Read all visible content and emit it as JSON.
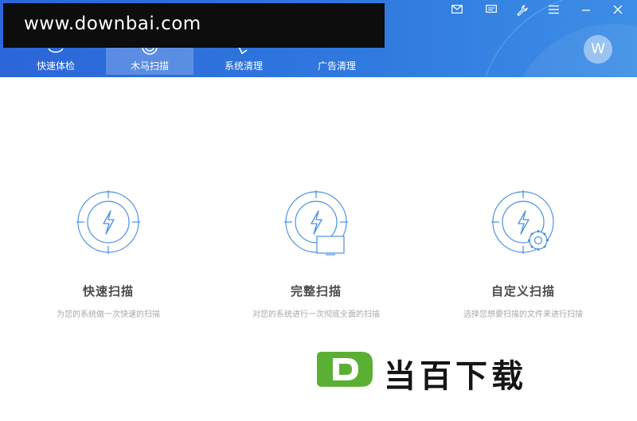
{
  "watermark": {
    "url": "www.downbai.com"
  },
  "nav": {
    "items": [
      {
        "label": "快速体检",
        "active": false
      },
      {
        "label": "木马扫描",
        "active": true
      },
      {
        "label": "系统清理",
        "active": false
      },
      {
        "label": "广告清理",
        "active": false
      }
    ]
  },
  "window_controls": [
    "mail-icon",
    "message-icon",
    "tools-icon",
    "menu-icon",
    "minimize-icon",
    "close-icon"
  ],
  "user": {
    "avatar_letter": "W"
  },
  "scan_options": [
    {
      "title": "快速扫描",
      "description": "为您的系统做一次快速的扫描",
      "icon": "lightning-target-icon"
    },
    {
      "title": "完整扫描",
      "description": "对您的系统进行一次彻底全面的扫描",
      "icon": "lightning-monitor-icon"
    },
    {
      "title": "自定义扫描",
      "description": "选择您想要扫描的文件来进行扫描",
      "icon": "lightning-gear-icon"
    }
  ],
  "brand_watermark": {
    "logo_letter": "D",
    "text": "当百下载"
  },
  "colors": {
    "header_blue": "#2c66d9",
    "icon_blue": "#4a8fe3",
    "logo_green": "#5bb033"
  }
}
